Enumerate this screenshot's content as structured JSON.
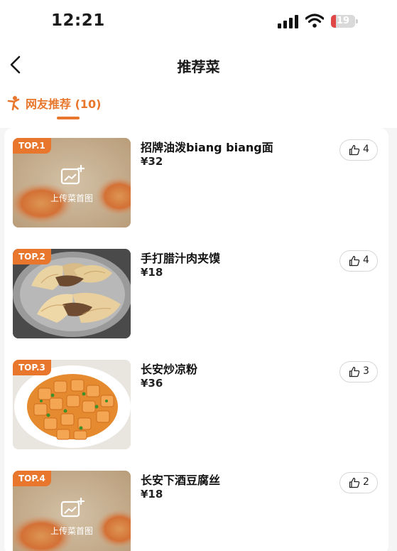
{
  "status_bar": {
    "time": "12:21",
    "battery": "19"
  },
  "nav": {
    "title": "推荐菜"
  },
  "section_tab": {
    "label": "网友推荐 (10)"
  },
  "colors": {
    "accent": "#e8762c",
    "battery_low": "#e04848"
  },
  "dishes": [
    {
      "rank": "TOP.1",
      "name": "招牌油泼biang biang面",
      "price": "¥32",
      "likes": "4",
      "photo": "placeholder",
      "upload_text": "上传菜首图"
    },
    {
      "rank": "TOP.2",
      "name": "手打腊汁肉夹馍",
      "price": "¥18",
      "likes": "4",
      "photo": "roujiamo"
    },
    {
      "rank": "TOP.3",
      "name": "长安炒凉粉",
      "price": "¥36",
      "likes": "3",
      "photo": "liangfen"
    },
    {
      "rank": "TOP.4",
      "name": "长安下酒豆腐丝",
      "price": "¥18",
      "likes": "2",
      "photo": "placeholder",
      "upload_text": "上传菜首图"
    }
  ]
}
